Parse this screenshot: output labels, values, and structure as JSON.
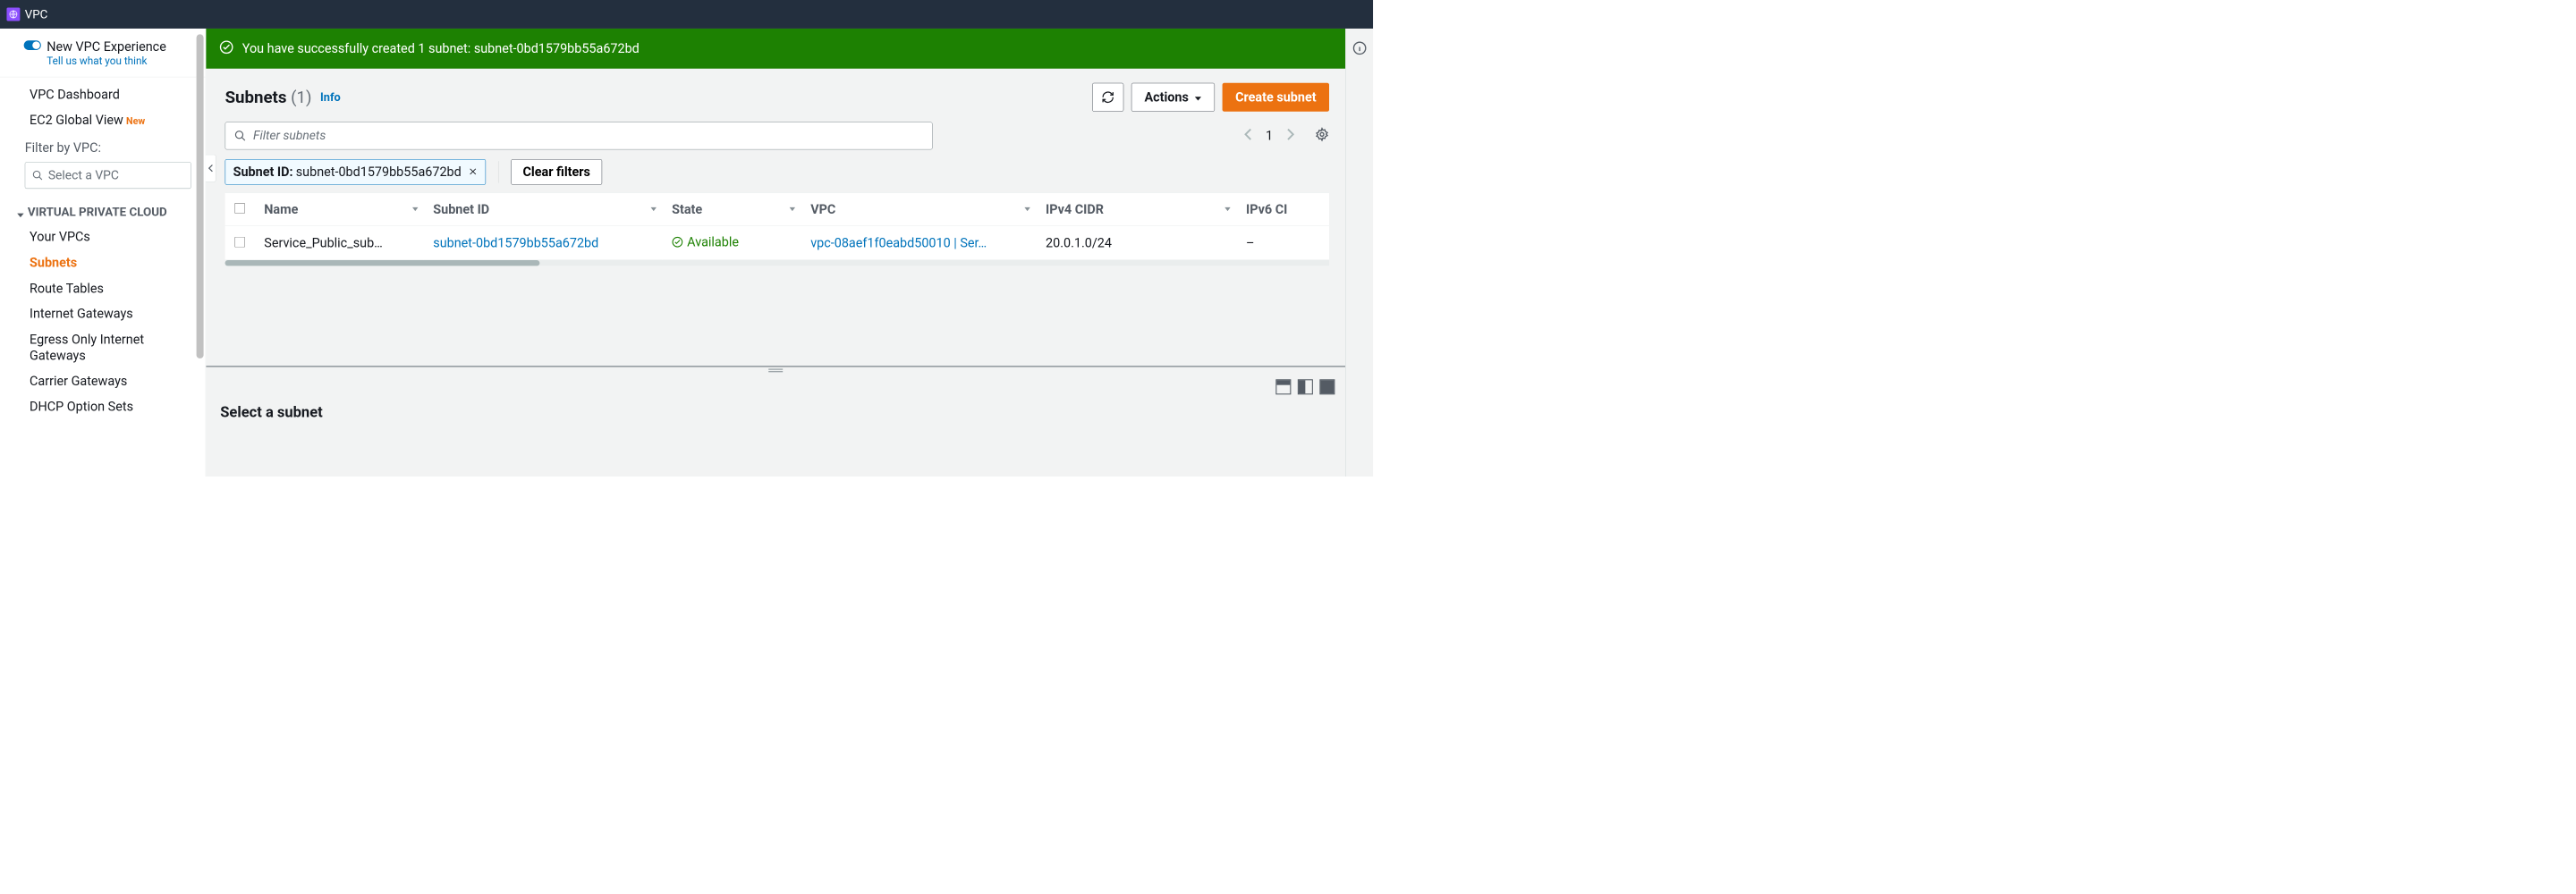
{
  "topbar": {
    "title": "VPC"
  },
  "sidebar": {
    "toggle_title": "New VPC Experience",
    "toggle_sub": "Tell us what you think",
    "items_top": [
      {
        "label": "VPC Dashboard"
      },
      {
        "label": "EC2 Global View",
        "badge": "New"
      }
    ],
    "filter_label": "Filter by VPC:",
    "filter_placeholder": "Select a VPC",
    "section": "VIRTUAL PRIVATE CLOUD",
    "items": [
      {
        "label": "Your VPCs"
      },
      {
        "label": "Subnets",
        "active": true
      },
      {
        "label": "Route Tables"
      },
      {
        "label": "Internet Gateways"
      },
      {
        "label": "Egress Only Internet Gateways"
      },
      {
        "label": "Carrier Gateways"
      },
      {
        "label": "DHCP Option Sets"
      }
    ]
  },
  "banner": {
    "text": "You have successfully created 1 subnet: subnet-0bd1579bb55a672bd"
  },
  "header": {
    "title": "Subnets",
    "count": "(1)",
    "info": "Info",
    "refresh": "Refresh",
    "actions": "Actions",
    "create": "Create subnet"
  },
  "search": {
    "placeholder": "Filter subnets"
  },
  "page": "1",
  "chip": {
    "key": "Subnet ID:",
    "value": "subnet-0bd1579bb55a672bd"
  },
  "clear_filters": "Clear filters",
  "columns": {
    "name": "Name",
    "subnet_id": "Subnet ID",
    "state": "State",
    "vpc": "VPC",
    "ipv4": "IPv4 CIDR",
    "ipv6": "IPv6 CI"
  },
  "rows": [
    {
      "name": "Service_Public_sub…",
      "subnet_id": "subnet-0bd1579bb55a672bd",
      "state": "Available",
      "vpc": "vpc-08aef1f0eabd50010 | Ser…",
      "ipv4": "20.0.1.0/24",
      "ipv6": "–"
    }
  ],
  "detail": {
    "title": "Select a subnet"
  }
}
